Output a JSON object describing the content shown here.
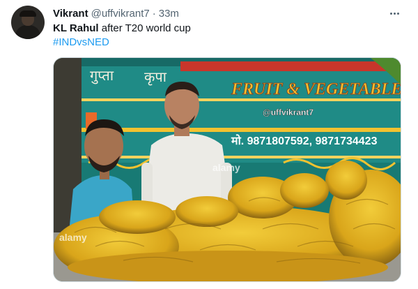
{
  "tweet": {
    "author_name": "Vikrant",
    "author_handle": "@uffvikrant7",
    "separator": "·",
    "time": "33m",
    "text_bold": "KL Rahul",
    "text_rest": " after T20 world cup",
    "hashtag": "#INDvsNED"
  },
  "image": {
    "truck_sign": "FRUIT & VEGETABLE SUPP",
    "watermark": "@uffvikrant7",
    "phone_text": "मो. 9871807592, 9871734423",
    "hindi_left": "गुप्ता",
    "hindi_right": "कृपा",
    "stock_watermark": "alamy"
  },
  "colors": {
    "link": "#1d9bf0",
    "truck_teal": "#1f8b86",
    "sign_yellow": "#f2c230",
    "banana_yellow": "#e8b820"
  }
}
